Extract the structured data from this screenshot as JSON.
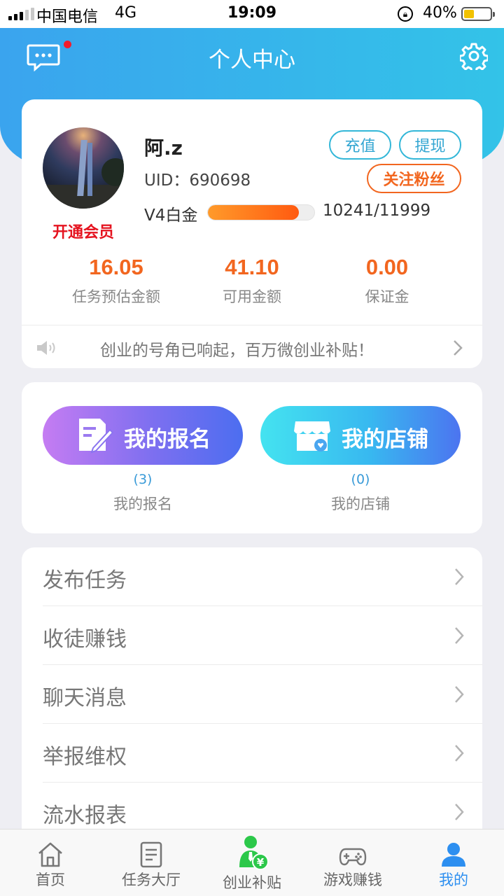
{
  "status_bar": {
    "carrier": "中国电信",
    "network": "4G",
    "time": "19:09",
    "battery_pct": "40%",
    "battery_level": 0.4
  },
  "header": {
    "title": "个人中心"
  },
  "profile": {
    "username": "阿.z",
    "uid": "UID：690698",
    "vip_label": "开通会员",
    "recharge_label": "充值",
    "withdraw_label": "提现",
    "follow_label": "关注粉丝",
    "level_label": "V4白金",
    "level_progress": "10241/11999",
    "level_fraction": 0.853
  },
  "stats": [
    {
      "value": "16.05",
      "label": "任务预估金额"
    },
    {
      "value": "41.10",
      "label": "可用金额"
    },
    {
      "value": "0.00",
      "label": "保证金"
    }
  ],
  "notice": {
    "text": "创业的号角已响起，百万微创业补贴！"
  },
  "shortcuts": [
    {
      "button": "我的报名",
      "count": "(3)",
      "label": "我的报名"
    },
    {
      "button": "我的店铺",
      "count": "(0)",
      "label": "我的店铺"
    }
  ],
  "menu": [
    "发布任务",
    "收徒赚钱",
    "聊天消息",
    "举报维权",
    "流水报表"
  ],
  "tabs": [
    {
      "label": "首页",
      "icon": "home-icon"
    },
    {
      "label": "任务大厅",
      "icon": "task-list-icon"
    },
    {
      "label": "创业补贴",
      "icon": "subsidy-icon"
    },
    {
      "label": "游戏赚钱",
      "icon": "gamepad-icon"
    },
    {
      "label": "我的",
      "icon": "user-icon",
      "active": true
    }
  ],
  "colors": {
    "accent_blue": "#3aa4ee",
    "orange": "#f2661f",
    "active_tab": "#2d8ff0",
    "vip_red": "#e5131f",
    "subsidy_green": "#2cc84a"
  }
}
